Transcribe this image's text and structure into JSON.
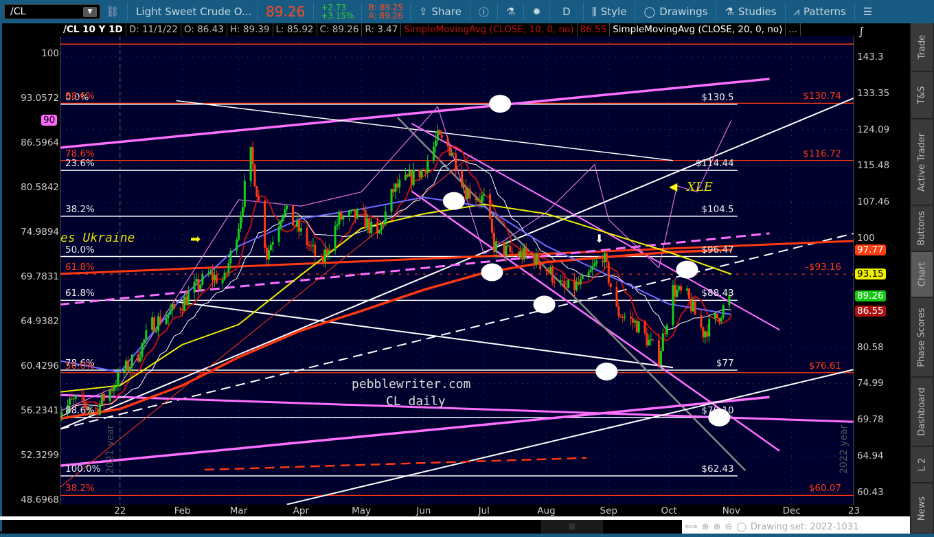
{
  "toolbar": {
    "symbol": "/CL",
    "description": "Light Sweet Crude O...",
    "last_price": "89.26",
    "change": "+2.73",
    "change_pct": "+3.15%",
    "bid": "B: 89.25",
    "ask": "A: 89.26",
    "share": "Share",
    "period": "D",
    "style": "Style",
    "drawings": "Drawings",
    "studies": "Studies",
    "patterns": "Patterns"
  },
  "infobar": {
    "symbol": "/CL 10 Y 1D",
    "date": "D: 11/1/22",
    "open": "O: 86.43",
    "high": "H: 89.39",
    "low": "L: 85.92",
    "close": "C: 89.26",
    "range": "R: 3.47",
    "study1": "SimpleMovingAvg (CLOSE, 10, 0, no)",
    "study1_value": "86.55",
    "study2": "SimpleMovingAvg (CLOSE, 20, 0, no)",
    "more": "..."
  },
  "side_tabs": [
    "Trade",
    "T&S",
    "Active Trader",
    "Buttons",
    "Chart",
    "Phase Scores",
    "Dashboard",
    "L 2",
    "News"
  ],
  "bottom": {
    "drawing_set": "Drawing set: 2022-1031"
  },
  "chart_data": {
    "type": "candlestick",
    "title": "CL daily",
    "watermark": "pebblewriter.com",
    "right_axis_ticks": [
      "143.3",
      "133.35",
      "124.09",
      "115.48",
      "107.46",
      "100",
      "80.58",
      "74.99",
      "69.78",
      "64.94",
      "60.43"
    ],
    "left_axis_ticks": [
      "100",
      "93.0572",
      "86.5964",
      "80.5842",
      "74.9894",
      "69.7831",
      "64.9382",
      "60.4296",
      "56.2341",
      "52.3299",
      "48.6968"
    ],
    "x_ticks": [
      [
        "22",
        "2022-01-01"
      ],
      [
        "Feb",
        "2022-02-01"
      ],
      [
        "Mar",
        "2022-03-01"
      ],
      [
        "Apr",
        "2022-04-01"
      ],
      [
        "May",
        "2022-05-01"
      ],
      [
        "Jun",
        "2022-06-01"
      ],
      [
        "Jul",
        "2022-07-01"
      ],
      [
        "Aug",
        "2022-08-01"
      ],
      [
        "Sep",
        "2022-09-01"
      ],
      [
        "Oct",
        "2022-10-01"
      ],
      [
        "Nov",
        "2022-11-01"
      ],
      [
        "Dec",
        "2022-12-01"
      ],
      [
        "23",
        "2023-01-01"
      ]
    ],
    "year_labels": [
      "2021 year",
      "2022 year"
    ],
    "badges": [
      {
        "label": "97.77",
        "value": 97.77,
        "bg": "#ff3d12",
        "fg": "#fff"
      },
      {
        "label": "93.15",
        "value": 93.15,
        "bg": "#f0f000",
        "fg": "#000"
      },
      {
        "label": "89.26",
        "value": 89.26,
        "bg": "#14c814",
        "fg": "#fff"
      },
      {
        "label": "86.55",
        "value": 86.55,
        "bg": "#b01010",
        "fg": "#fff"
      }
    ],
    "left_badge": {
      "label": "90",
      "value": 89.8,
      "bg": "#ff66ff",
      "fg": "#000"
    },
    "weekly_closes": [
      [
        "2021-12-01",
        70.9
      ],
      [
        "2021-12-10",
        72.5
      ],
      [
        "2021-12-20",
        71.2
      ],
      [
        "2022-01-03",
        76.9
      ],
      [
        "2022-01-10",
        79.5
      ],
      [
        "2022-01-17",
        84.3
      ],
      [
        "2022-01-25",
        86.0
      ],
      [
        "2022-02-01",
        88.0
      ],
      [
        "2022-02-07",
        90.5
      ],
      [
        "2022-02-14",
        92.9
      ],
      [
        "2022-02-22",
        92.0
      ],
      [
        "2022-03-01",
        103.0
      ],
      [
        "2022-03-07",
        118.0
      ],
      [
        "2022-03-15",
        96.8
      ],
      [
        "2022-03-23",
        106.0
      ],
      [
        "2022-04-01",
        101.0
      ],
      [
        "2022-04-11",
        95.0
      ],
      [
        "2022-04-20",
        104.0
      ],
      [
        "2022-05-01",
        104.7
      ],
      [
        "2022-05-09",
        100.0
      ],
      [
        "2022-05-17",
        110.0
      ],
      [
        "2022-06-01",
        114.7
      ],
      [
        "2022-06-08",
        122.0
      ],
      [
        "2022-06-15",
        119.0
      ],
      [
        "2022-06-22",
        110.0
      ],
      [
        "2022-07-01",
        108.0
      ],
      [
        "2022-07-06",
        98.5
      ],
      [
        "2022-07-15",
        97.0
      ],
      [
        "2022-07-25",
        96.5
      ],
      [
        "2022-08-01",
        94.2
      ],
      [
        "2022-08-10",
        90.3
      ],
      [
        "2022-08-20",
        91.5
      ],
      [
        "2022-08-29",
        97.0
      ],
      [
        "2022-09-05",
        86.5
      ],
      [
        "2022-09-15",
        84.3
      ],
      [
        "2022-09-26",
        79.0
      ],
      [
        "2022-10-03",
        90.3
      ],
      [
        "2022-10-10",
        89.0
      ],
      [
        "2022-10-18",
        83.0
      ],
      [
        "2022-10-25",
        85.5
      ],
      [
        "2022-11-01",
        89.26
      ]
    ],
    "moving_averages": [
      {
        "name": "SMA200",
        "color": "#ff3a10",
        "points": [
          [
            "2021-12-01",
            69.9
          ],
          [
            "2022-01-01",
            71.3
          ],
          [
            "2022-02-01",
            74.7
          ],
          [
            "2022-03-01",
            79.0
          ],
          [
            "2022-04-01",
            83.3
          ],
          [
            "2022-05-01",
            86.6
          ],
          [
            "2022-06-01",
            90.3
          ],
          [
            "2022-07-01",
            93.4
          ],
          [
            "2022-08-01",
            95.4
          ],
          [
            "2022-09-01",
            96.4
          ],
          [
            "2022-10-01",
            97.3
          ],
          [
            "2022-11-01",
            97.77
          ]
        ]
      },
      {
        "name": "SMA100",
        "color": "#f0f000",
        "points": [
          [
            "2021-12-01",
            73.7
          ],
          [
            "2022-01-01",
            74.7
          ],
          [
            "2022-02-01",
            81.0
          ],
          [
            "2022-03-01",
            84.3
          ],
          [
            "2022-04-01",
            93.0
          ],
          [
            "2022-05-01",
            102.0
          ],
          [
            "2022-06-01",
            105.0
          ],
          [
            "2022-07-01",
            107.0
          ],
          [
            "2022-08-01",
            105.0
          ],
          [
            "2022-09-01",
            101.0
          ],
          [
            "2022-10-01",
            97.3
          ],
          [
            "2022-11-01",
            93.15
          ]
        ]
      },
      {
        "name": "SMA50",
        "color": "#6d6dff",
        "points": [
          [
            "2021-12-01",
            78.5
          ],
          [
            "2022-01-01",
            76.7
          ],
          [
            "2022-02-01",
            89.0
          ],
          [
            "2022-03-01",
            98.5
          ],
          [
            "2022-04-01",
            104.0
          ],
          [
            "2022-05-01",
            106.0
          ],
          [
            "2022-06-01",
            108.5
          ],
          [
            "2022-07-01",
            106.5
          ],
          [
            "2022-08-01",
            98.5
          ],
          [
            "2022-09-01",
            92.9
          ],
          [
            "2022-10-01",
            87.8
          ],
          [
            "2022-11-01",
            86.0
          ]
        ]
      }
    ],
    "computed_sma": [
      {
        "name": "SMA10",
        "length": 10,
        "color": "#c01010"
      },
      {
        "name": "SMA20",
        "length": 20,
        "color": "#ffffff"
      }
    ],
    "comparison": {
      "name": "XLE",
      "color": "#e070e0",
      "points": [
        [
          "2021-12-01",
          56.1
        ],
        [
          "2022-01-01",
          58.6
        ],
        [
          "2022-02-01",
          68.5
        ],
        [
          "2022-03-01",
          79.0
        ],
        [
          "2022-04-01",
          78.2
        ],
        [
          "2022-05-01",
          80.0
        ],
        [
          "2022-06-08",
          91.8
        ],
        [
          "2022-07-01",
          72.4
        ],
        [
          "2022-08-01",
          77.4
        ],
        [
          "2022-08-25",
          83.6
        ],
        [
          "2022-09-01",
          76.5
        ],
        [
          "2022-09-26",
          70.8
        ],
        [
          "2022-10-05",
          80.8
        ],
        [
          "2022-10-15",
          80.0
        ],
        [
          "2022-11-01",
          89.8
        ]
      ]
    },
    "white_levels": [
      {
        "label": "$130.5",
        "price": 130.5,
        "pct": "0.0%"
      },
      {
        "label": "$114.44",
        "price": 114.44,
        "pct": "23.6%"
      },
      {
        "label": "$104.5",
        "price": 104.5,
        "pct": "38.2%"
      },
      {
        "label": "$96.47",
        "price": 96.47,
        "pct": "50.0%"
      },
      {
        "label": "$88.43",
        "price": 88.43,
        "pct": "61.8%"
      },
      {
        "label": "$77",
        "price": 77,
        "pct": "78.6%"
      },
      {
        "label": "$70.10",
        "price": 70.1,
        "pct": "88.6%"
      },
      {
        "label": "$62.43",
        "price": 62.43,
        "pct": "100.0%"
      }
    ],
    "red_levels": [
      {
        "label": "$130.74",
        "price": 130.74,
        "pct": "88.6%"
      },
      {
        "label": "$116.72",
        "price": 116.72,
        "pct": "78.6%"
      },
      {
        "label": "-$93.16",
        "price": 93.16,
        "pct": "61.8%"
      },
      {
        "label": "$76.61",
        "price": 76.61,
        "pct": "50.0%"
      },
      {
        "label": "$60.07",
        "price": 60.07,
        "pct": "38.2%"
      }
    ],
    "trendlines": [
      {
        "color": "#ff70ff",
        "w": 3.5,
        "from": [
          "2021-12-02",
          119.7
        ],
        "to": [
          "2022-11-20",
          137.2
        ]
      },
      {
        "color": "#ffffff",
        "w": 2,
        "from": [
          "2021-12-02",
          68.5
        ],
        "to": [
          "2023-01-01",
          132.1
        ]
      },
      {
        "color": "#ffffff",
        "w": 2,
        "dash": "14 8",
        "from": [
          "2021-12-02",
          68.5
        ],
        "to": [
          "2023-01-01",
          101.0
        ]
      },
      {
        "color": "#ff3a10",
        "w": 3,
        "from": [
          "2021-12-02",
          93.2
        ],
        "to": [
          "2023-01-01",
          99.5
        ]
      },
      {
        "color": "#ff70ff",
        "w": 3,
        "dash": "14 8",
        "from": [
          "2021-12-02",
          87.7
        ],
        "to": [
          "2022-11-20",
          101.0
        ]
      },
      {
        "color": "#ffffff",
        "w": 1.5,
        "from": [
          "2022-01-29",
          131.4
        ],
        "to": [
          "2022-10-03",
          116.7
        ]
      },
      {
        "color": "#ffffff",
        "w": 2,
        "from": [
          "2022-01-29",
          88.2
        ],
        "to": [
          "2022-10-03",
          77.4
        ]
      },
      {
        "color": "#ff70ff",
        "w": 2,
        "from": [
          "2022-05-26",
          125.6
        ],
        "to": [
          "2022-11-25",
          83.4
        ]
      },
      {
        "color": "#ff70ff",
        "w": 2.5,
        "from": [
          "2022-05-26",
          109.8
        ],
        "to": [
          "2022-11-25",
          65.6
        ]
      },
      {
        "color": "#888888",
        "w": 2.5,
        "from": [
          "2022-05-19",
          127.1
        ],
        "to": [
          "2022-11-08",
          63.1
        ]
      },
      {
        "color": "#ff70ff",
        "w": 3,
        "from": [
          "2021-12-02",
          73.3
        ],
        "to": [
          "2023-01-01",
          69.5
        ]
      },
      {
        "color": "#ff70ff",
        "w": 3.5,
        "from": [
          "2021-12-02",
          63.7
        ],
        "to": [
          "2022-11-20",
          73.0
        ]
      },
      {
        "color": "#ffffff",
        "w": 2,
        "from": [
          "2022-03-25",
          59.0
        ],
        "to": [
          "2023-01-01",
          77.1
        ]
      },
      {
        "color": "#ff3a10",
        "w": 2.5,
        "dash": "14 8",
        "from": [
          "2022-02-12",
          63.2
        ],
        "to": [
          "2022-08-21",
          64.7
        ]
      },
      {
        "color": "#ff3a10",
        "w": 1,
        "from": [
          "2021-12-02",
          61.0
        ],
        "to": [
          "2022-06-25",
          118.0
        ]
      }
    ],
    "markers": [
      [
        "2022-07-09",
        130.6
      ],
      [
        "2022-07-05",
        93.5
      ],
      [
        "2022-07-31",
        87.7
      ],
      [
        "2022-08-31",
        76.8
      ],
      [
        "2022-10-10",
        94.0
      ],
      [
        "2022-10-26",
        70.1
      ],
      [
        "2022-06-16",
        107.7
      ]
    ],
    "annotations": {
      "ukraine": "es Ukraine",
      "xle": "XLE",
      "xle_arrow": "◀",
      "right_arrow": "➡",
      "down_arrow": "⬇"
    }
  }
}
